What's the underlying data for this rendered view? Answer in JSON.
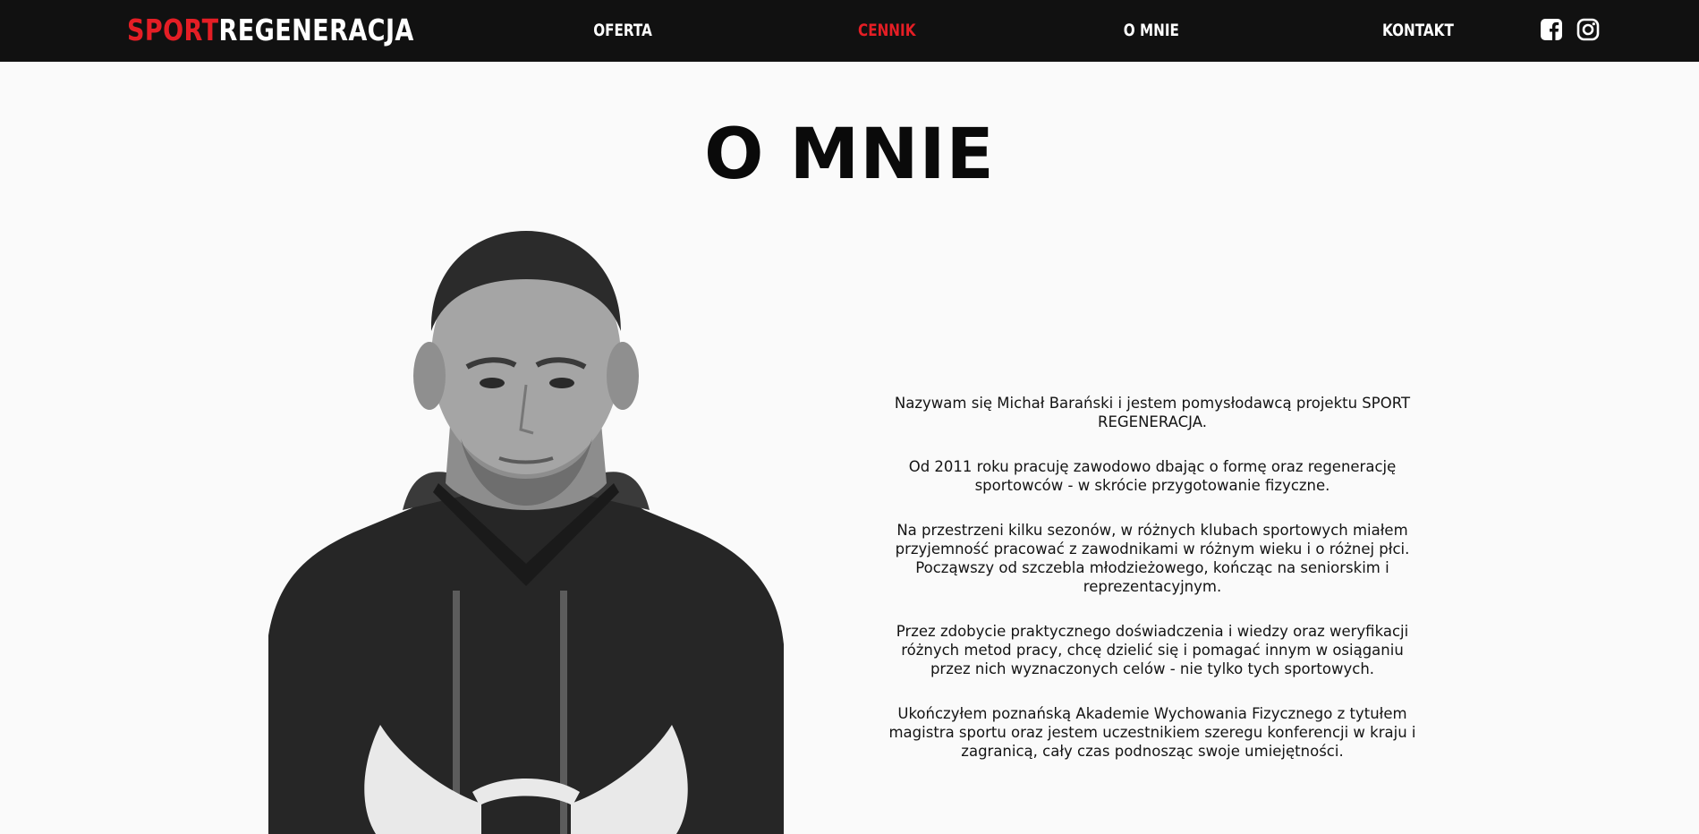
{
  "header": {
    "logo": {
      "part_a": "SPORT",
      "part_b": "REGENERACJA"
    },
    "nav": [
      {
        "label": "OFERTA",
        "active": false
      },
      {
        "label": "CENNIK",
        "active": true
      },
      {
        "label": "O MNIE",
        "active": false
      },
      {
        "label": "KONTAKT",
        "active": false
      }
    ],
    "social": [
      "facebook-icon",
      "instagram-icon"
    ]
  },
  "main": {
    "title": "O MNIE",
    "bio": [
      "Nazywam się Michał Barański i jestem pomysłodawcą projektu SPORT REGENERACJA.",
      "Od 2011 roku pracuję zawodowo dbając o formę oraz regenerację sportowców - w skrócie przygotowanie fizyczne.",
      "Na przestrzeni kilku sezonów, w różnych klubach sportowych miałem przyjemność pracować z zawodnikami w różnym wieku i o różnej płci. Począwszy od szczebla młodzieżowego, kończąc na seniorskim i reprezentacyjnym.",
      "Przez zdobycie praktycznego doświadczenia i wiedzy oraz weryfikacji różnych metod pracy, chcę dzielić się i pomagać innym w osiąganiu przez nich wyznaczonych celów - nie tylko tych sportowych.",
      "Ukończyłem poznańską Akademie Wychowania Fizycznego z tytułem magistra sportu oraz jestem uczestnikiem szeregu konferencji w kraju i zagranicą, cały czas podnosząc swoje umiejętności."
    ]
  },
  "colors": {
    "accent": "#e51e25",
    "nav_background": "#111111",
    "page_background": "#fafafa"
  }
}
